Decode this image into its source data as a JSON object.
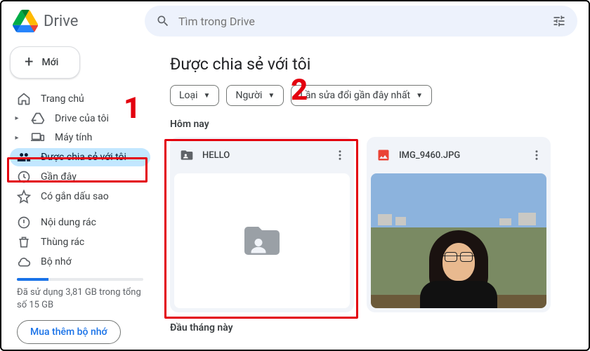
{
  "brand": {
    "name": "Drive"
  },
  "search": {
    "placeholder": "Tìm trong Drive"
  },
  "new_button": {
    "label": "Mới"
  },
  "sidebar": {
    "items": [
      {
        "id": "home",
        "label": "Trang chủ",
        "icon": "home-icon"
      },
      {
        "id": "my-drive",
        "label": "Drive của tôi",
        "icon": "drive-icon",
        "expandable": true
      },
      {
        "id": "computers",
        "label": "Máy tính",
        "icon": "devices-icon",
        "expandable": true
      },
      {
        "id": "shared",
        "label": "Được chia sẻ với tôi",
        "icon": "people-icon",
        "active": true
      },
      {
        "id": "recent",
        "label": "Gần đây",
        "icon": "clock-icon"
      },
      {
        "id": "starred",
        "label": "Có gắn dấu sao",
        "icon": "star-icon"
      },
      {
        "id": "spam",
        "label": "Nội dung rác",
        "icon": "spam-icon"
      },
      {
        "id": "trash",
        "label": "Thùng rác",
        "icon": "trash-icon"
      },
      {
        "id": "storage",
        "label": "Bộ nhớ",
        "icon": "cloud-icon"
      }
    ]
  },
  "storage": {
    "text": "Đã sử dụng 3,81 GB trong tổng số 15 GB",
    "percent": 25,
    "buy_label": "Mua thêm bộ nhớ"
  },
  "main": {
    "title": "Được chia sẻ với tôi",
    "filters": [
      {
        "label": "Loại"
      },
      {
        "label": "Người"
      },
      {
        "label": "Lần sửa đổi gần đây nhất"
      }
    ],
    "sections": [
      {
        "label": "Hôm nay",
        "items": [
          {
            "type": "folder",
            "name": "HELLO",
            "icon": "shared-folder-icon"
          },
          {
            "type": "image",
            "name": "IMG_9460.JPG",
            "icon": "image-icon",
            "icon_color": "#ea4335"
          }
        ]
      },
      {
        "label": "Đầu tháng này",
        "items": []
      }
    ]
  },
  "annotations": {
    "one": "1",
    "two": "2"
  }
}
